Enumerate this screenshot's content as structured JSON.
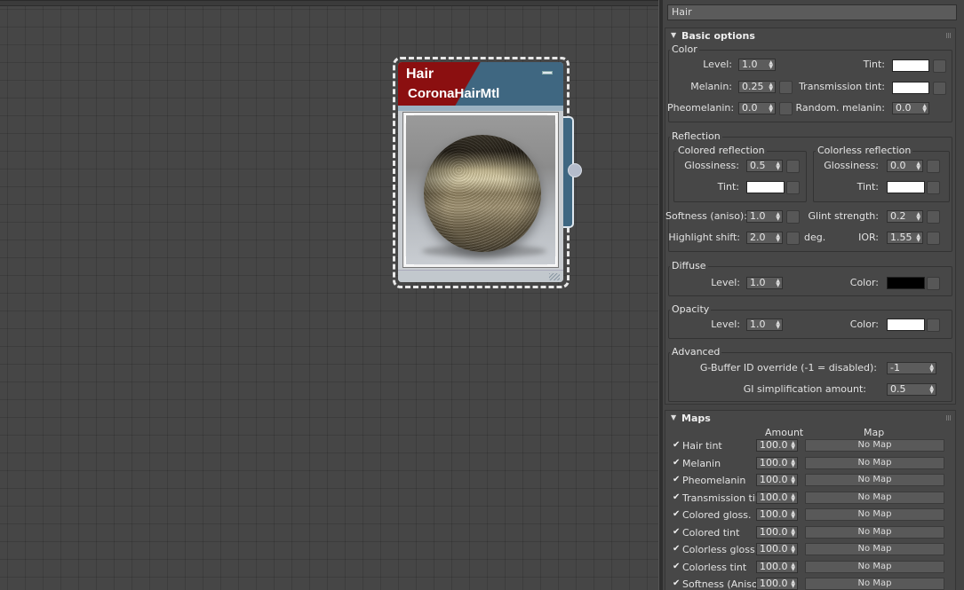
{
  "material_name": "Hair",
  "node": {
    "title": "Hair",
    "type": "CoronaHairMtl"
  },
  "basic": {
    "title": "Basic options",
    "color_group": "Color",
    "level_label": "Level:",
    "level": "1.0",
    "tint_label": "Tint:",
    "melanin_label": "Melanin:",
    "melanin": "0.25",
    "transmission_tint_label": "Transmission tint:",
    "pheomelanin_label": "Pheomelanin:",
    "pheomelanin": "0.0",
    "random_melanin_label": "Random. melanin:",
    "random_melanin": "0.0",
    "reflection_group": "Reflection",
    "colored_reflection": "Colored reflection",
    "colorless_reflection": "Colorless reflection",
    "glossiness_label": "Glossiness:",
    "colored_glossiness": "0.5",
    "colorless_glossiness": "0.0",
    "softness_label": "Softness (aniso):",
    "softness": "1.0",
    "glint_label": "Glint strength:",
    "glint": "0.2",
    "highlight_shift_label": "Highlight shift:",
    "highlight_shift": "2.0",
    "deg": "deg.",
    "ior_label": "IOR:",
    "ior": "1.55",
    "diffuse_group": "Diffuse",
    "diffuse_level": "1.0",
    "color_label": "Color:",
    "opacity_group": "Opacity",
    "opacity_level": "1.0",
    "advanced_group": "Advanced",
    "gbuffer_label": "G-Buffer ID override (-1 = disabled):",
    "gbuffer": "-1",
    "gi_label": "GI simplification amount:",
    "gi": "0.5"
  },
  "colors": {
    "white": "#ffffff",
    "black": "#000000",
    "node_red": "#8b0f10",
    "node_blue": "#3f6781"
  },
  "maps": {
    "title": "Maps",
    "amount_header": "Amount",
    "map_header": "Map",
    "rows": [
      {
        "name": "Hair tint",
        "amount": "100.0",
        "map": "No Map"
      },
      {
        "name": "Melanin",
        "amount": "100.0",
        "map": "No Map"
      },
      {
        "name": "Pheomelanin",
        "amount": "100.0",
        "map": "No Map"
      },
      {
        "name": "Transmission tint",
        "amount": "100.0",
        "map": "No Map"
      },
      {
        "name": "Colored gloss.",
        "amount": "100.0",
        "map": "No Map"
      },
      {
        "name": "Colored tint",
        "amount": "100.0",
        "map": "No Map"
      },
      {
        "name": "Colorless gloss.",
        "amount": "100.0",
        "map": "No Map"
      },
      {
        "name": "Colorless tint",
        "amount": "100.0",
        "map": "No Map"
      },
      {
        "name": "Softness (Aniso)",
        "amount": "100.0",
        "map": "No Map"
      }
    ]
  }
}
